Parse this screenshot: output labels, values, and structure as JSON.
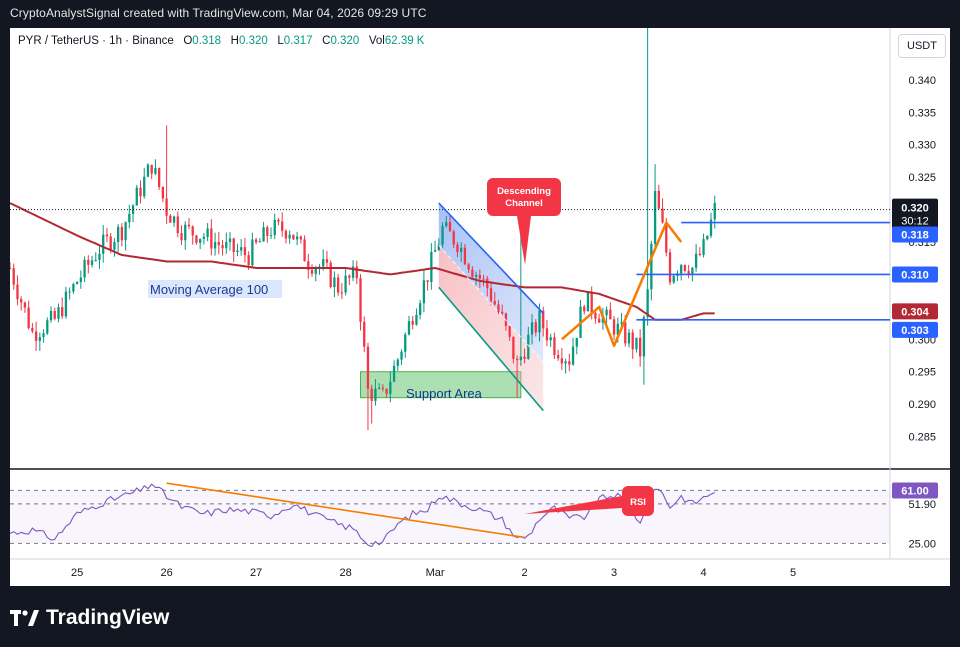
{
  "header": {
    "caption": "CryptoAnalystSignal created with TradingView.com, Mar 04, 2026 09:29 UTC"
  },
  "legend": {
    "symbol": "PYR / TetherUS · 1h · Binance",
    "o_label": "O",
    "o_value": "0.318",
    "h_label": "H",
    "h_value": "0.320",
    "l_label": "L",
    "l_value": "0.317",
    "c_label": "C",
    "c_value": "0.320",
    "vol_label": "Vol",
    "vol_value": "62.39 K"
  },
  "currency_button": "USDT",
  "footer": {
    "brand": "TradingView"
  },
  "colors": {
    "up": "#089981",
    "down": "#f23645",
    "ma": "#b22833",
    "level": "#2962ff",
    "rsi": "#7e57c2",
    "trend": "#f57c00"
  },
  "annotations": {
    "descending_channel": "Descending Channel",
    "moving_average": "Moving Average 100",
    "support_area": "Support Area",
    "rsi": "RSI"
  },
  "price_badges": {
    "last": "0.320",
    "countdown": "30:12",
    "l1": "0.318",
    "l2": "0.310",
    "l3": "0.304",
    "l4": "0.303"
  },
  "chart_data": [
    {
      "type": "candlestick",
      "title": "PYR / TetherUS · 1h · Binance",
      "ylim": [
        0.28,
        0.348
      ],
      "y_ticks": [
        "0.340",
        "0.335",
        "0.330",
        "0.325",
        "0.320",
        "0.315",
        "0.310",
        "0.305",
        "0.300",
        "0.295",
        "0.290",
        "0.285"
      ],
      "x_ticks": [
        "25",
        "26",
        "27",
        "28",
        "Mar",
        "2",
        "3",
        "4",
        "5"
      ],
      "x_tick_hours": [
        0,
        24,
        48,
        72,
        96,
        120,
        144,
        168,
        192
      ],
      "x_range_hours": [
        -18,
        218
      ],
      "close_anchors": [
        [
          -18,
          0.311
        ],
        [
          -12,
          0.301
        ],
        [
          -6,
          0.303
        ],
        [
          0,
          0.309
        ],
        [
          6,
          0.314
        ],
        [
          12,
          0.317
        ],
        [
          16,
          0.322
        ],
        [
          20,
          0.327
        ],
        [
          24,
          0.32
        ],
        [
          28,
          0.317
        ],
        [
          34,
          0.316
        ],
        [
          40,
          0.314
        ],
        [
          46,
          0.313
        ],
        [
          52,
          0.317
        ],
        [
          57,
          0.317
        ],
        [
          62,
          0.312
        ],
        [
          66,
          0.311
        ],
        [
          70,
          0.308
        ],
        [
          75,
          0.31
        ],
        [
          78,
          0.292
        ],
        [
          82,
          0.291
        ],
        [
          86,
          0.297
        ],
        [
          90,
          0.304
        ],
        [
          94,
          0.31
        ],
        [
          98,
          0.317
        ],
        [
          102,
          0.315
        ],
        [
          106,
          0.311
        ],
        [
          110,
          0.308
        ],
        [
          114,
          0.303
        ],
        [
          118,
          0.296
        ],
        [
          121,
          0.3
        ],
        [
          124,
          0.303
        ],
        [
          128,
          0.299
        ],
        [
          132,
          0.297
        ],
        [
          136,
          0.306
        ],
        [
          140,
          0.304
        ],
        [
          144,
          0.302
        ],
        [
          148,
          0.3
        ],
        [
          151,
          0.298
        ],
        [
          153,
          0.307
        ],
        [
          155,
          0.322
        ],
        [
          157,
          0.317
        ],
        [
          159,
          0.31
        ],
        [
          162,
          0.312
        ],
        [
          165,
          0.311
        ],
        [
          168,
          0.314
        ],
        [
          171,
          0.32
        ]
      ],
      "high_spikes": [
        [
          24,
          0.333
        ],
        [
          153,
          0.348
        ],
        [
          155,
          0.327
        ],
        [
          119,
          0.318
        ]
      ],
      "low_spikes": [
        [
          78,
          0.286
        ],
        [
          79,
          0.287
        ],
        [
          118,
          0.291
        ],
        [
          152,
          0.293
        ],
        [
          154,
          0.306
        ]
      ],
      "moving_average_100": [
        [
          -18,
          0.321
        ],
        [
          0,
          0.316
        ],
        [
          12,
          0.313
        ],
        [
          24,
          0.312
        ],
        [
          36,
          0.312
        ],
        [
          48,
          0.311
        ],
        [
          60,
          0.311
        ],
        [
          72,
          0.311
        ],
        [
          84,
          0.31
        ],
        [
          96,
          0.311
        ],
        [
          108,
          0.309
        ],
        [
          120,
          0.308
        ],
        [
          130,
          0.308
        ],
        [
          140,
          0.307
        ],
        [
          150,
          0.305
        ],
        [
          155,
          0.303
        ],
        [
          162,
          0.303
        ],
        [
          168,
          0.304
        ],
        [
          171,
          0.304
        ]
      ],
      "last_price": 0.32,
      "horizontal_levels": [
        0.318,
        0.31,
        0.303
      ],
      "support_area": [
        0.291,
        0.295
      ],
      "descending_channel": {
        "upper": [
          [
            97,
            0.321
          ],
          [
            125,
            0.304
          ]
        ],
        "lower": [
          [
            97,
            0.308
          ],
          [
            125,
            0.289
          ]
        ]
      },
      "projection_path": [
        [
          130,
          0.3
        ],
        [
          140,
          0.305
        ],
        [
          144,
          0.299
        ],
        [
          158,
          0.318
        ],
        [
          162,
          0.315
        ]
      ]
    },
    {
      "type": "line",
      "title": "RSI",
      "ylim": [
        15,
        75
      ],
      "y_ticks": [
        "61.14",
        "51.90",
        "25.00"
      ],
      "reference_lines": [
        61.14,
        51.9,
        25.0
      ],
      "current_value": "61.00",
      "anchors": [
        [
          -18,
          32
        ],
        [
          -12,
          34
        ],
        [
          -6,
          28
        ],
        [
          0,
          45
        ],
        [
          6,
          52
        ],
        [
          12,
          57
        ],
        [
          18,
          62
        ],
        [
          20,
          66
        ],
        [
          24,
          57
        ],
        [
          28,
          50
        ],
        [
          34,
          45
        ],
        [
          40,
          48
        ],
        [
          46,
          47
        ],
        [
          52,
          44
        ],
        [
          58,
          52
        ],
        [
          64,
          44
        ],
        [
          70,
          38
        ],
        [
          74,
          35
        ],
        [
          78,
          25
        ],
        [
          82,
          26
        ],
        [
          86,
          38
        ],
        [
          90,
          45
        ],
        [
          94,
          48
        ],
        [
          97,
          58
        ],
        [
          102,
          53
        ],
        [
          108,
          48
        ],
        [
          114,
          41
        ],
        [
          118,
          28
        ],
        [
          121,
          30
        ],
        [
          124,
          42
        ],
        [
          128,
          49
        ],
        [
          132,
          42
        ],
        [
          136,
          43
        ],
        [
          140,
          55
        ],
        [
          144,
          58
        ],
        [
          148,
          53
        ],
        [
          151,
          38
        ],
        [
          153,
          55
        ],
        [
          155,
          64
        ],
        [
          157,
          59
        ],
        [
          159,
          50
        ],
        [
          162,
          57
        ],
        [
          165,
          52
        ],
        [
          168,
          56
        ],
        [
          171,
          61
        ]
      ],
      "trendline": [
        [
          24,
          66
        ],
        [
          120,
          29
        ]
      ],
      "rsi_arrow_to": [
        [
          120,
          45
        ]
      ]
    }
  ]
}
